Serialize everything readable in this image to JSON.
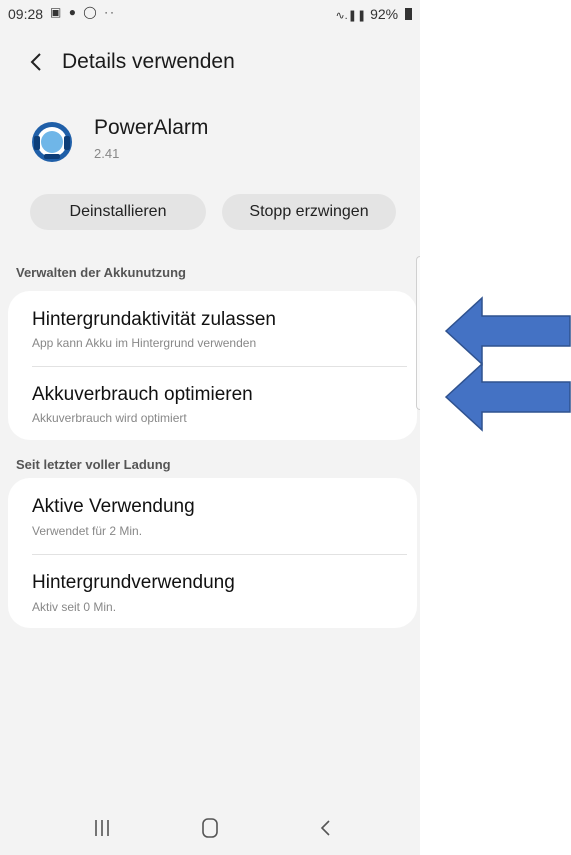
{
  "status_bar": {
    "time": "09:28",
    "notification_icons": [
      "image-icon",
      "shield-icon",
      "whatsapp-icon",
      "more-icon"
    ],
    "signal": "wifi-signal-icons",
    "battery": "92%"
  },
  "header": {
    "title": "Details verwenden",
    "back_icon": "chevron-left-icon"
  },
  "app": {
    "name": "PowerAlarm",
    "version": "2.41"
  },
  "actions": {
    "uninstall_label": "Deinstallieren",
    "force_stop_label": "Stopp erzwingen"
  },
  "battery_management": {
    "section_title": "Verwalten der Akkunutzung",
    "items": [
      {
        "title": "Hintergrundaktivität zulassen",
        "subtitle": "App kann Akku im Hintergrund verwenden"
      },
      {
        "title": "Akkuverbrauch optimieren",
        "subtitle": "Akkuverbrauch wird optimiert"
      }
    ]
  },
  "since_last_charge": {
    "section_title": "Seit letzter voller Ladung",
    "items": [
      {
        "title": "Aktive Verwendung",
        "subtitle": "Verwendet für 2 Min."
      },
      {
        "title": "Hintergrundverwendung",
        "subtitle": "Aktiv seit 0 Min."
      }
    ]
  },
  "nav_bar": {
    "icons": [
      "recent-apps-icon",
      "home-icon",
      "back-icon"
    ]
  },
  "colors": {
    "background": "#f3f3f3",
    "card": "#ffffff",
    "arrow_fill": "#4472c4",
    "arrow_stroke": "#2f528f"
  }
}
